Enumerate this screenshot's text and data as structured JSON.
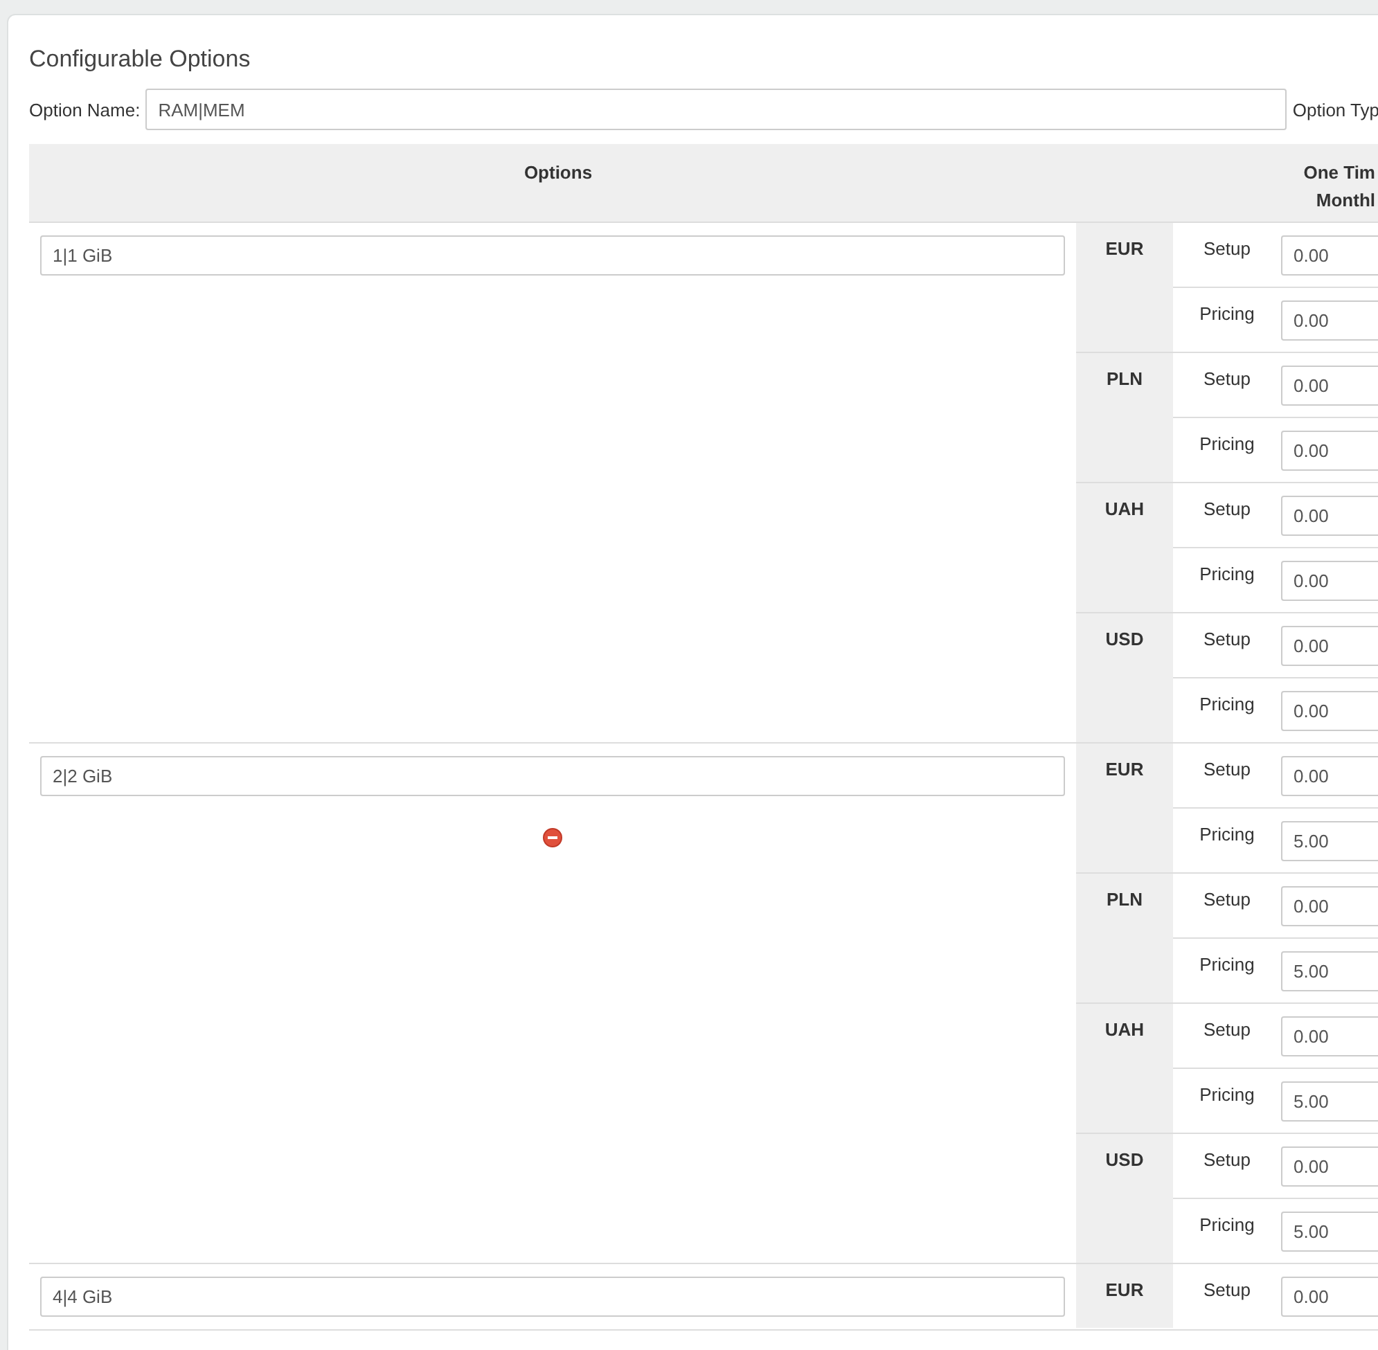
{
  "panel": {
    "title": "Configurable Options"
  },
  "option_name": {
    "label": "Option Name:",
    "value": "RAM|MEM",
    "type_label": "Option Typ"
  },
  "table": {
    "columns": [
      "Options"
    ],
    "cycle_header": [
      "One Tim",
      "Monthl"
    ],
    "options": [
      {
        "name": "1|1 GiB",
        "removable": false,
        "currencies": [
          {
            "code": "EUR",
            "rows": [
              {
                "label": "Setup",
                "value": "0.00"
              },
              {
                "label": "Pricing",
                "value": "0.00"
              }
            ]
          },
          {
            "code": "PLN",
            "rows": [
              {
                "label": "Setup",
                "value": "0.00"
              },
              {
                "label": "Pricing",
                "value": "0.00"
              }
            ]
          },
          {
            "code": "UAH",
            "rows": [
              {
                "label": "Setup",
                "value": "0.00"
              },
              {
                "label": "Pricing",
                "value": "0.00"
              }
            ]
          },
          {
            "code": "USD",
            "rows": [
              {
                "label": "Setup",
                "value": "0.00"
              },
              {
                "label": "Pricing",
                "value": "0.00"
              }
            ]
          }
        ]
      },
      {
        "name": "2|2 GiB",
        "removable": true,
        "currencies": [
          {
            "code": "EUR",
            "rows": [
              {
                "label": "Setup",
                "value": "0.00"
              },
              {
                "label": "Pricing",
                "value": "5.00"
              }
            ]
          },
          {
            "code": "PLN",
            "rows": [
              {
                "label": "Setup",
                "value": "0.00"
              },
              {
                "label": "Pricing",
                "value": "5.00"
              }
            ]
          },
          {
            "code": "UAH",
            "rows": [
              {
                "label": "Setup",
                "value": "0.00"
              },
              {
                "label": "Pricing",
                "value": "5.00"
              }
            ]
          },
          {
            "code": "USD",
            "rows": [
              {
                "label": "Setup",
                "value": "0.00"
              },
              {
                "label": "Pricing",
                "value": "5.00"
              }
            ]
          }
        ]
      },
      {
        "name": "4|4 GiB",
        "removable": false,
        "currencies": [
          {
            "code": "EUR",
            "rows": [
              {
                "label": "Setup",
                "value": "0.00"
              }
            ]
          }
        ]
      }
    ]
  }
}
